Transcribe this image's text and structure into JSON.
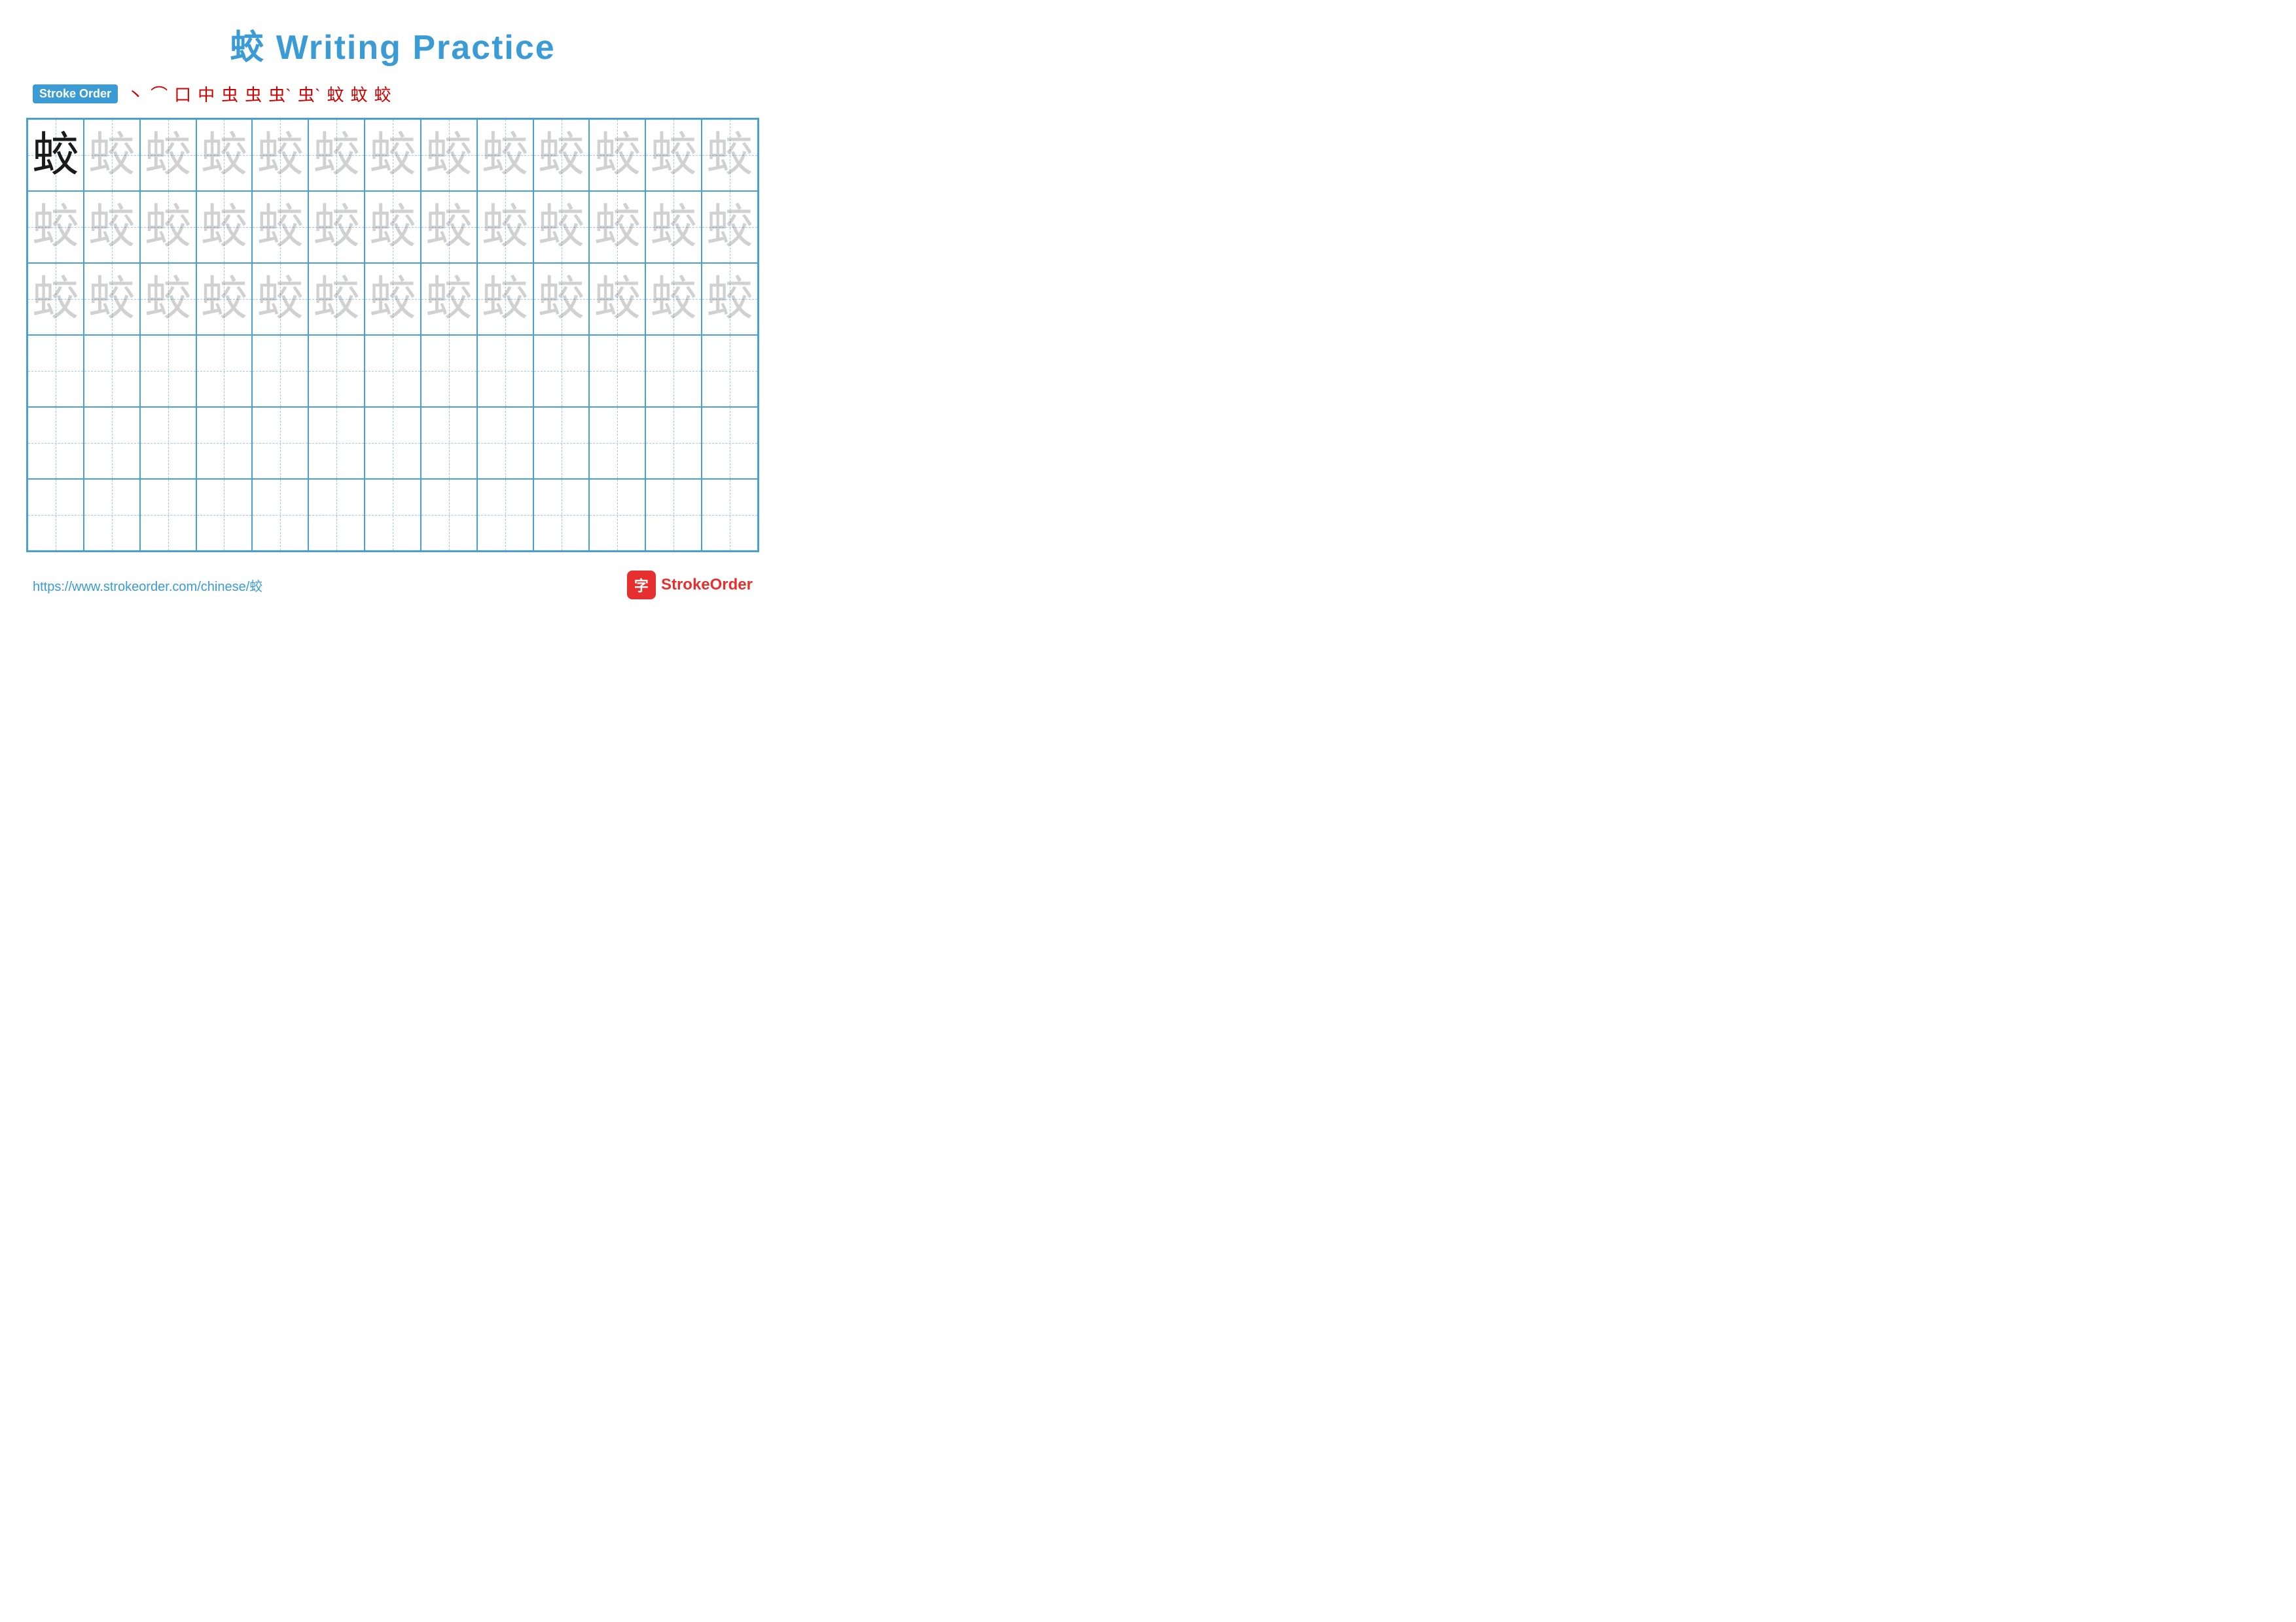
{
  "title": {
    "char": "蛟",
    "text": " Writing Practice"
  },
  "stroke_order": {
    "badge_label": "Stroke Order",
    "steps": [
      "丶",
      "⌒",
      "口",
      "中",
      "虫",
      "虫",
      "虫`",
      "虫`",
      "蚊",
      "蚊",
      "蛟"
    ]
  },
  "grid": {
    "cols": 13,
    "rows": 6,
    "char": "蛟",
    "row_styles": [
      "solid",
      "faded-dark",
      "faded-dark",
      "empty",
      "empty",
      "empty"
    ]
  },
  "footer": {
    "url": "https://www.strokeorder.com/chinese/蛟",
    "logo_char": "字",
    "logo_text_part1": "Stroke",
    "logo_text_part2": "Order"
  }
}
